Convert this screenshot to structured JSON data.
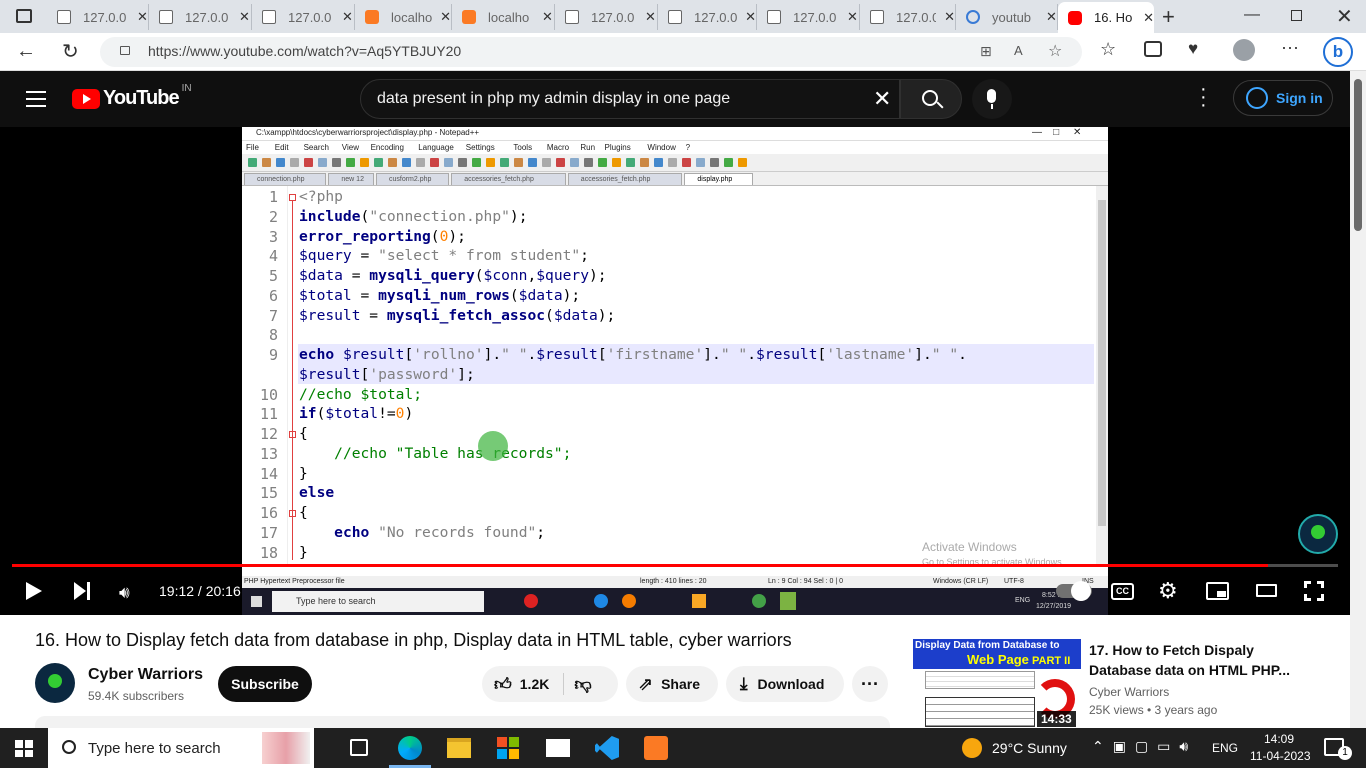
{
  "browser": {
    "tabs": [
      {
        "label": "127.0.0",
        "icon": "page-icon"
      },
      {
        "label": "127.0.0",
        "icon": "page-icon"
      },
      {
        "label": "127.0.0",
        "icon": "page-icon"
      },
      {
        "label": "localho",
        "icon": "xampp-icon"
      },
      {
        "label": "localho",
        "icon": "xampp-icon"
      },
      {
        "label": "127.0.0",
        "icon": "page-icon"
      },
      {
        "label": "127.0.0",
        "icon": "page-icon"
      },
      {
        "label": "127.0.0",
        "icon": "page-icon"
      },
      {
        "label": "127.0.0",
        "icon": "page-icon"
      },
      {
        "label": "youtub",
        "icon": "search-icon"
      },
      {
        "label": "16. Ho",
        "icon": "youtube-icon",
        "active": true
      }
    ],
    "url": "https://www.youtube.com/watch?v=Aq5YTBJUY20"
  },
  "youtube": {
    "logo": "YouTube",
    "region": "IN",
    "search_query": "data present in php my admin  display in one page",
    "sign_in": "Sign in"
  },
  "npp": {
    "titlebar": "C:\\xampp\\htdocs\\cyberwarriorsproject\\display.php - Notepad++",
    "menus": [
      "File",
      "Edit",
      "Search",
      "View",
      "Encoding",
      "Language",
      "Settings",
      "Tools",
      "Macro",
      "Run",
      "Plugins",
      "Window",
      "?"
    ],
    "file_tabs": [
      "connection.php",
      "new 12",
      "cusform2.php",
      "accessories_fetch.php",
      "accessories_fetch.php",
      "display.php"
    ],
    "line_numbers": [
      "1",
      "2",
      "3",
      "4",
      "5",
      "6",
      "7",
      "8",
      "9",
      "",
      "10",
      "11",
      "12",
      "13",
      "14",
      "15",
      "16",
      "17",
      "18"
    ],
    "status": {
      "left": "PHP Hypertext Preprocessor file",
      "length": "length : 410   lines : 20",
      "pos": "Ln : 9   Col : 94   Sel : 0 | 0",
      "eol": "Windows (CR LF)",
      "enc": "UTF-8",
      "mode": "INS"
    },
    "watermark_title": "Activate Windows",
    "watermark_sub": "Go to Settings to activate Windows.",
    "inner_taskbar_search": "Type here to search",
    "inner_clock": "8:52 PM",
    "inner_date": "12/27/2019",
    "inner_lang": "ENG"
  },
  "player": {
    "time": "19:12 / 20:16",
    "progress": 0.947
  },
  "video": {
    "title": "16. How to Display fetch data from database in php, Display data in HTML table, cyber warriors",
    "channel": "Cyber Warriors",
    "subscribers": "59.4K subscribers",
    "subscribe": "Subscribe",
    "likes": "1.2K",
    "share": "Share",
    "download": "Download"
  },
  "related": {
    "thumb_line1": "Display Data from Database to",
    "thumb_line2": "Web Page",
    "thumb_part": "PART II",
    "duration": "14:33",
    "title": "17. How to Fetch Dispaly Database data on HTML PHP...",
    "channel": "Cyber Warriors",
    "meta": "25K views  •  3 years ago"
  },
  "taskbar": {
    "search": "Type here to search",
    "weather": "29°C  Sunny",
    "lang": "ENG",
    "time": "14:09",
    "date": "11-04-2023",
    "notifications": "1"
  },
  "colors": {
    "yt_red": "#ff0000",
    "npp_keyword": "#000080",
    "npp_string": "#808080",
    "npp_number": "#ff8000",
    "npp_comment": "#008000"
  }
}
